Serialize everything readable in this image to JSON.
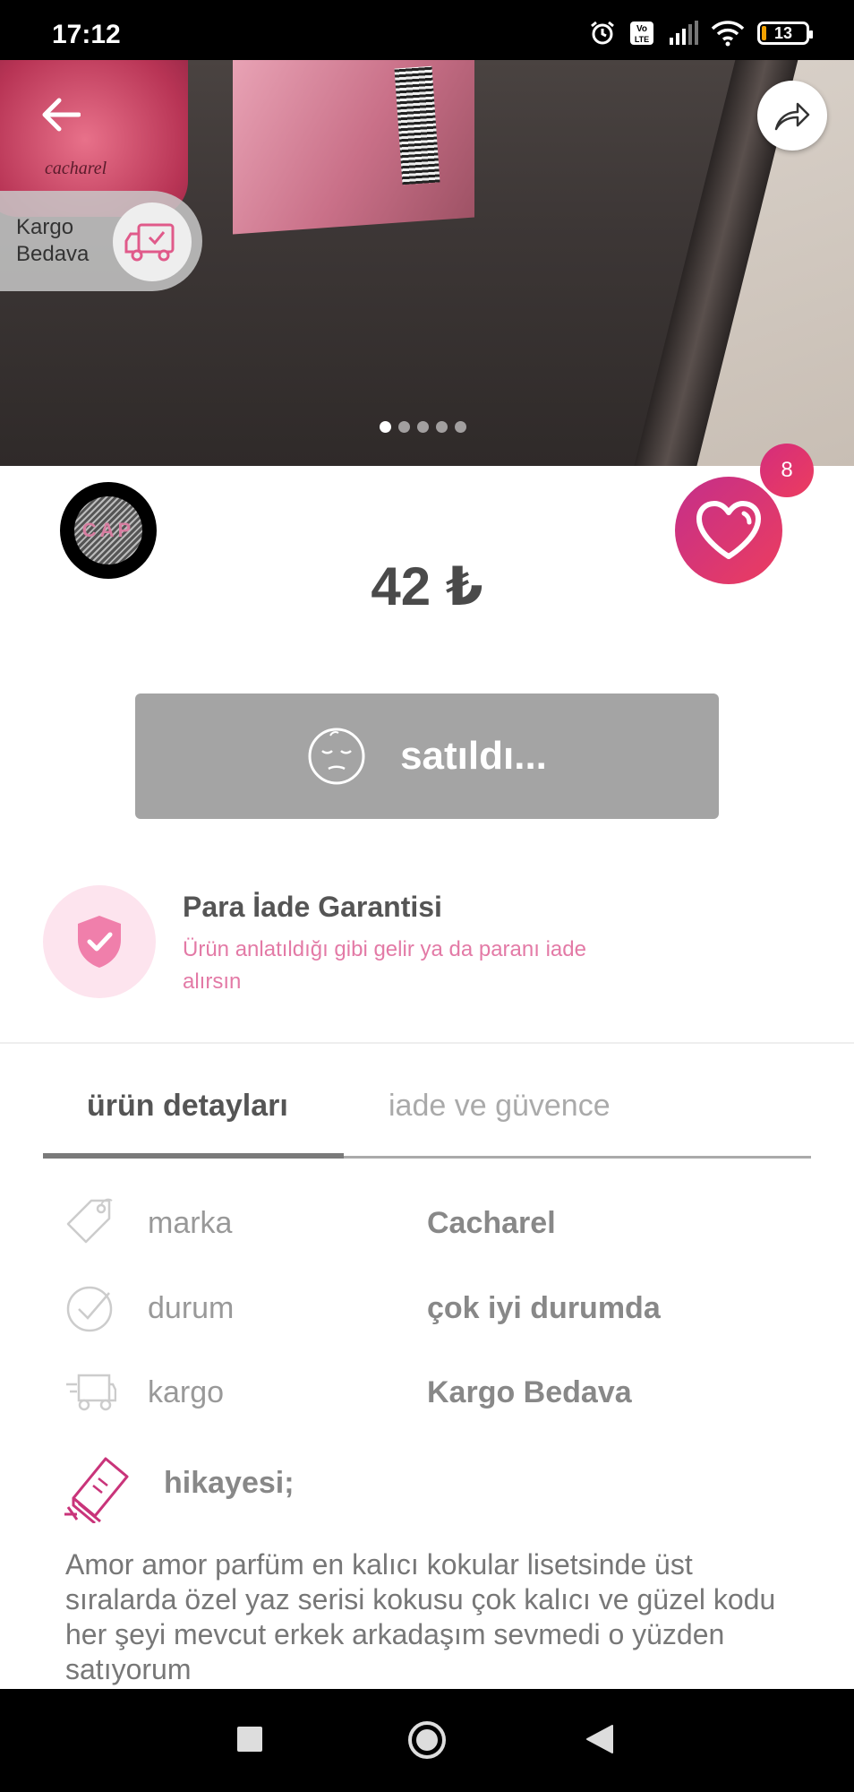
{
  "status_bar": {
    "time": "17:12",
    "battery": "13"
  },
  "hero": {
    "bottle_brand": "cacharel",
    "image_count": 5,
    "active_index": 0
  },
  "cargo_badge": {
    "line1": "Kargo",
    "line2": "Bedava"
  },
  "seller": {
    "avatar_text": "CAP"
  },
  "product": {
    "price": "42 ₺",
    "likes": "8"
  },
  "sold_button": {
    "label": "satıldı..."
  },
  "guarantee": {
    "title": "Para İade Garantisi",
    "subtitle": "Ürün anlatıldığı gibi gelir ya da paranı iade alırsın"
  },
  "tabs": [
    {
      "label": "ürün detayları",
      "active": true
    },
    {
      "label": "iade ve güvence",
      "active": false
    }
  ],
  "details": [
    {
      "key": "marka",
      "value": "Cacharel",
      "icon": "tag-icon"
    },
    {
      "key": "durum",
      "value": "çok iyi durumda",
      "icon": "check-circle-icon"
    },
    {
      "key": "kargo",
      "value": "Kargo Bedava",
      "icon": "truck-icon"
    }
  ],
  "story": {
    "title": "hikayesi;",
    "text": "Amor amor parfüm en kalıcı kokular lisetsinde üst sıralarda özel yaz serisi kokusu çok kalıcı ve güzel kodu her şeyi mevcut erkek arkadaşım sevmedi o yüzden satıyorum"
  },
  "colors": {
    "accent": "#e8407a",
    "sold_gray": "#a4a4a4",
    "pink_light": "#fde4ee"
  }
}
